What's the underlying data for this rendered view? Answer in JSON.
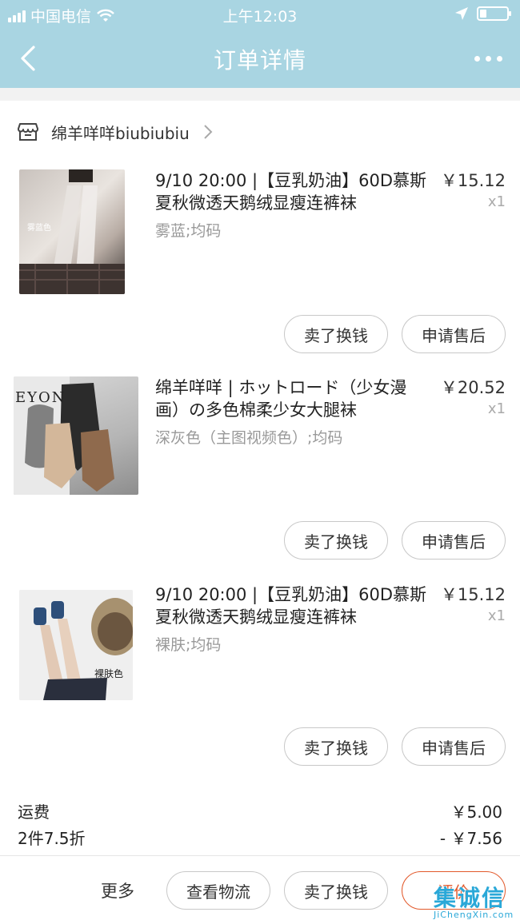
{
  "status_bar": {
    "carrier": "中国电信",
    "time": "上午12:03",
    "battery_level": 0.25
  },
  "nav": {
    "title": "订单详情",
    "icons": [
      "chevron-left-icon",
      "more-dots-icon"
    ]
  },
  "shop": {
    "name": "绵羊咩咩biubiubiu",
    "icon": "store-icon"
  },
  "items": [
    {
      "title": "9/10 20:00 |【豆乳奶油】60D慕斯夏秋微透天鹅绒显瘦连裤袜",
      "sku": "雾蓝;均码",
      "price": "￥15.12",
      "qty": "x1",
      "thumb_caption": "雾蓝色",
      "btn_sell": "卖了换钱",
      "btn_after_sale": "申请售后"
    },
    {
      "title": "绵羊咩咩 | ホットロード（少女漫画）の多色棉柔少女大腿袜",
      "sku": "深灰色（主图视频色）;均码",
      "price": "￥20.52",
      "qty": "x1",
      "thumb_caption": "EYON",
      "btn_sell": "卖了换钱",
      "btn_after_sale": "申请售后"
    },
    {
      "title": "9/10 20:00 |【豆乳奶油】60D慕斯夏秋微透天鹅绒显瘦连裤袜",
      "sku": "裸肤;均码",
      "price": "￥15.12",
      "qty": "x1",
      "thumb_caption": "裸肤色",
      "btn_sell": "卖了换钱",
      "btn_after_sale": "申请售后"
    }
  ],
  "fees": [
    {
      "label": "运费",
      "value": "￥5.00"
    },
    {
      "label": "2件7.5折",
      "value": "- ￥7.56"
    }
  ],
  "bottom_bar": {
    "more": "更多",
    "logistics": "查看物流",
    "sell": "卖了换钱",
    "rate": "评价"
  },
  "watermark": {
    "text": "集诚信",
    "sub": "JiChengXin.com"
  },
  "colors": {
    "header": "#a9d5e2",
    "accent": "#e2592b",
    "watermark": "#2aa8d8"
  }
}
